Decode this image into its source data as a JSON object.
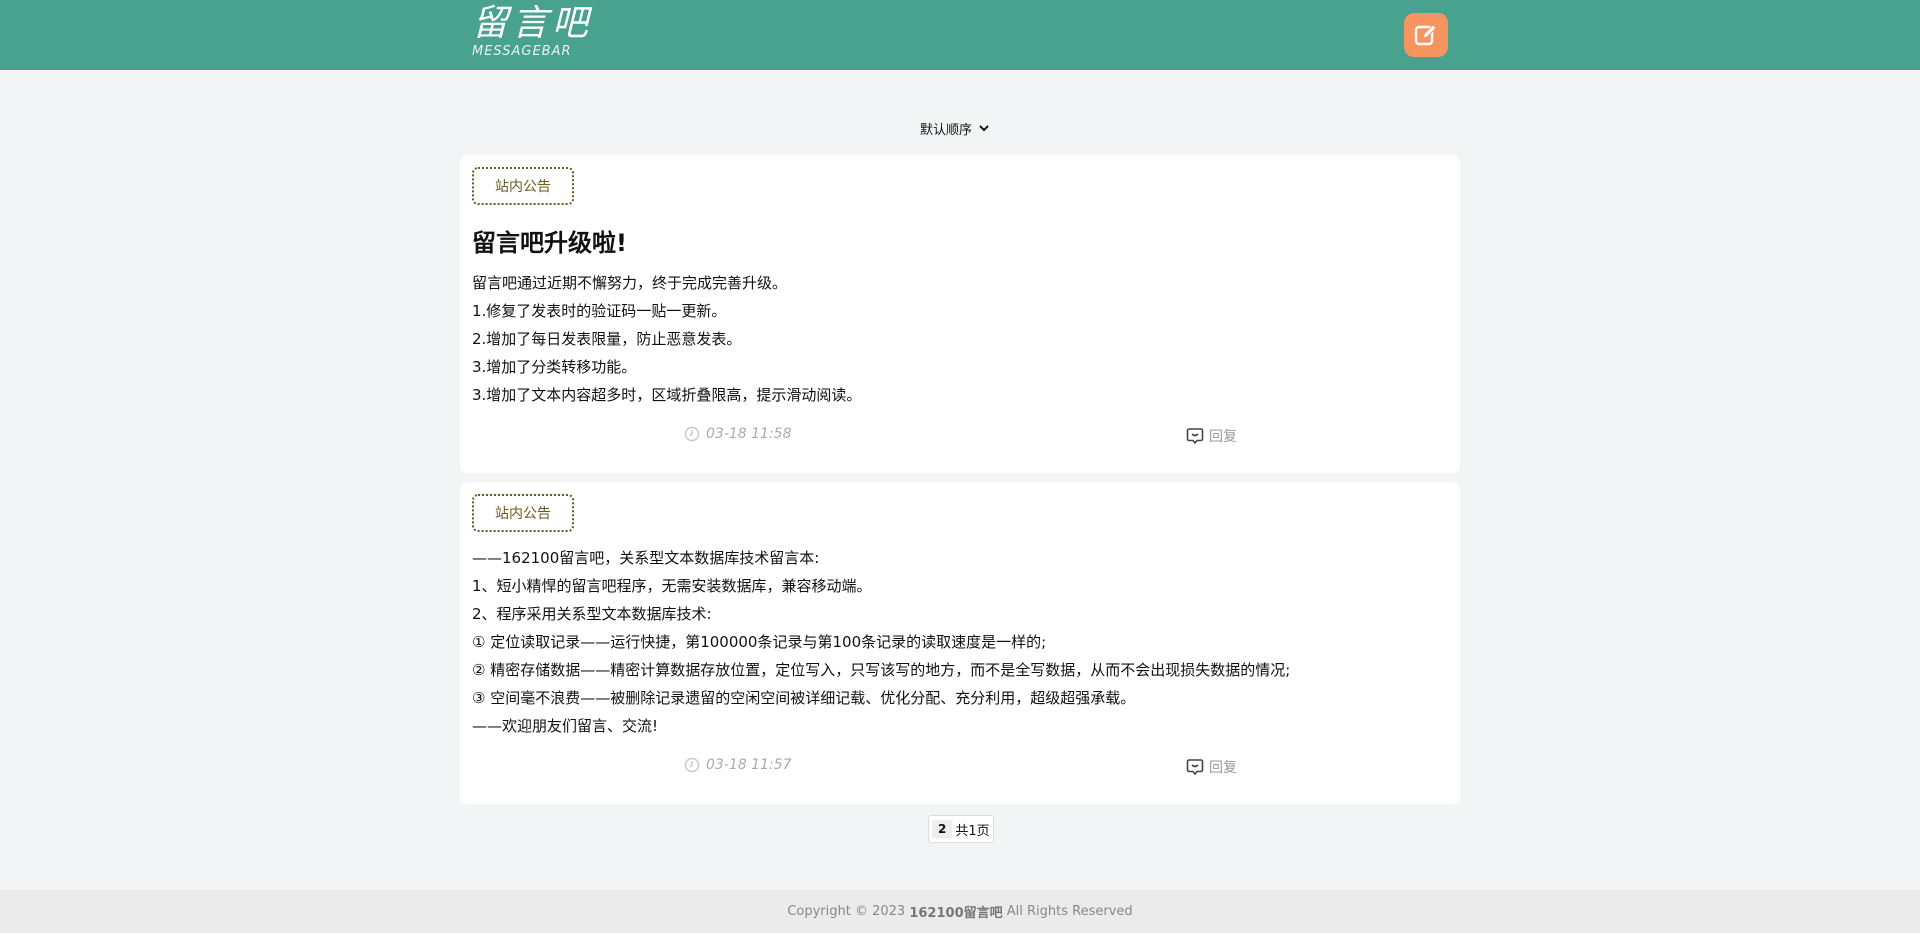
{
  "header": {
    "logo_cn": "留言吧",
    "logo_en": "MESSAGEBAR",
    "write_icon": "edit-icon",
    "colors": {
      "bar": "#48a28e",
      "write_button": "#f79561"
    }
  },
  "sort": {
    "selected": "默认顺序"
  },
  "posts": [
    {
      "tag": "站内公告",
      "title": "留言吧升级啦!",
      "lines": [
        "留言吧通过近期不懈努力，终于完成完善升级。",
        "1.修复了发表时的验证码一贴一更新。",
        "2.增加了每日发表限量，防止恶意发表。",
        "3.增加了分类转移功能。",
        "3.增加了文本内容超多时，区域折叠限高，提示滑动阅读。"
      ],
      "time": "03-18 11:58",
      "reply": "回复"
    },
    {
      "tag": "站内公告",
      "lines": [
        "——162100留言吧，关系型文本数据库技术留言本:",
        "1、短小精悍的留言吧程序，无需安装数据库，兼容移动端。",
        "2、程序采用关系型文本数据库技术:",
        "① 定位读取记录——运行快捷，第100000条记录与第100条记录的读取速度是一样的;",
        "② 精密存储数据——精密计算数据存放位置，定位写入，只写该写的地方，而不是全写数据，从而不会出现损失数据的情况;",
        "③ 空间毫不浪费——被删除记录遗留的空闲空间被详细记载、优化分配、充分利用，超级超强承载。",
        "——欢迎朋友们留言、交流!"
      ],
      "time": "03-18 11:57",
      "reply": "回复"
    }
  ],
  "pagination": {
    "current": "2",
    "total_text": "共1页"
  },
  "footer": {
    "prefix": "Copyright © 2023",
    "brand": "162100留言吧",
    "suffix": "All Rights Reserved"
  }
}
